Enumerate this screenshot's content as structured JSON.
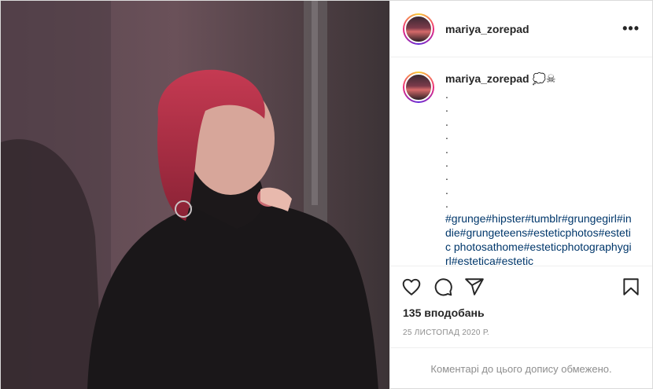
{
  "post": {
    "username": "mariya_zorepad",
    "caption": {
      "emoji": "💭☠",
      "dots": [
        ".",
        ".",
        ".",
        ".",
        ".",
        ".",
        ".",
        ".",
        "."
      ],
      "hashtags": "#grunge#hipster#tumblr#grungegirl#indie#grungeteens#esteticphotos#estetic photosathome#esteticphotographygirl#estetica#estetic"
    },
    "likes": "135 вподобань",
    "date": "25 ЛИСТОПАД 2020 Р.",
    "comments_notice": "Коментарі до цього допису обмежено."
  },
  "icons": {
    "more": "more-options-icon",
    "like": "heart-icon",
    "comment": "comment-icon",
    "share": "share-icon",
    "save": "bookmark-icon"
  }
}
